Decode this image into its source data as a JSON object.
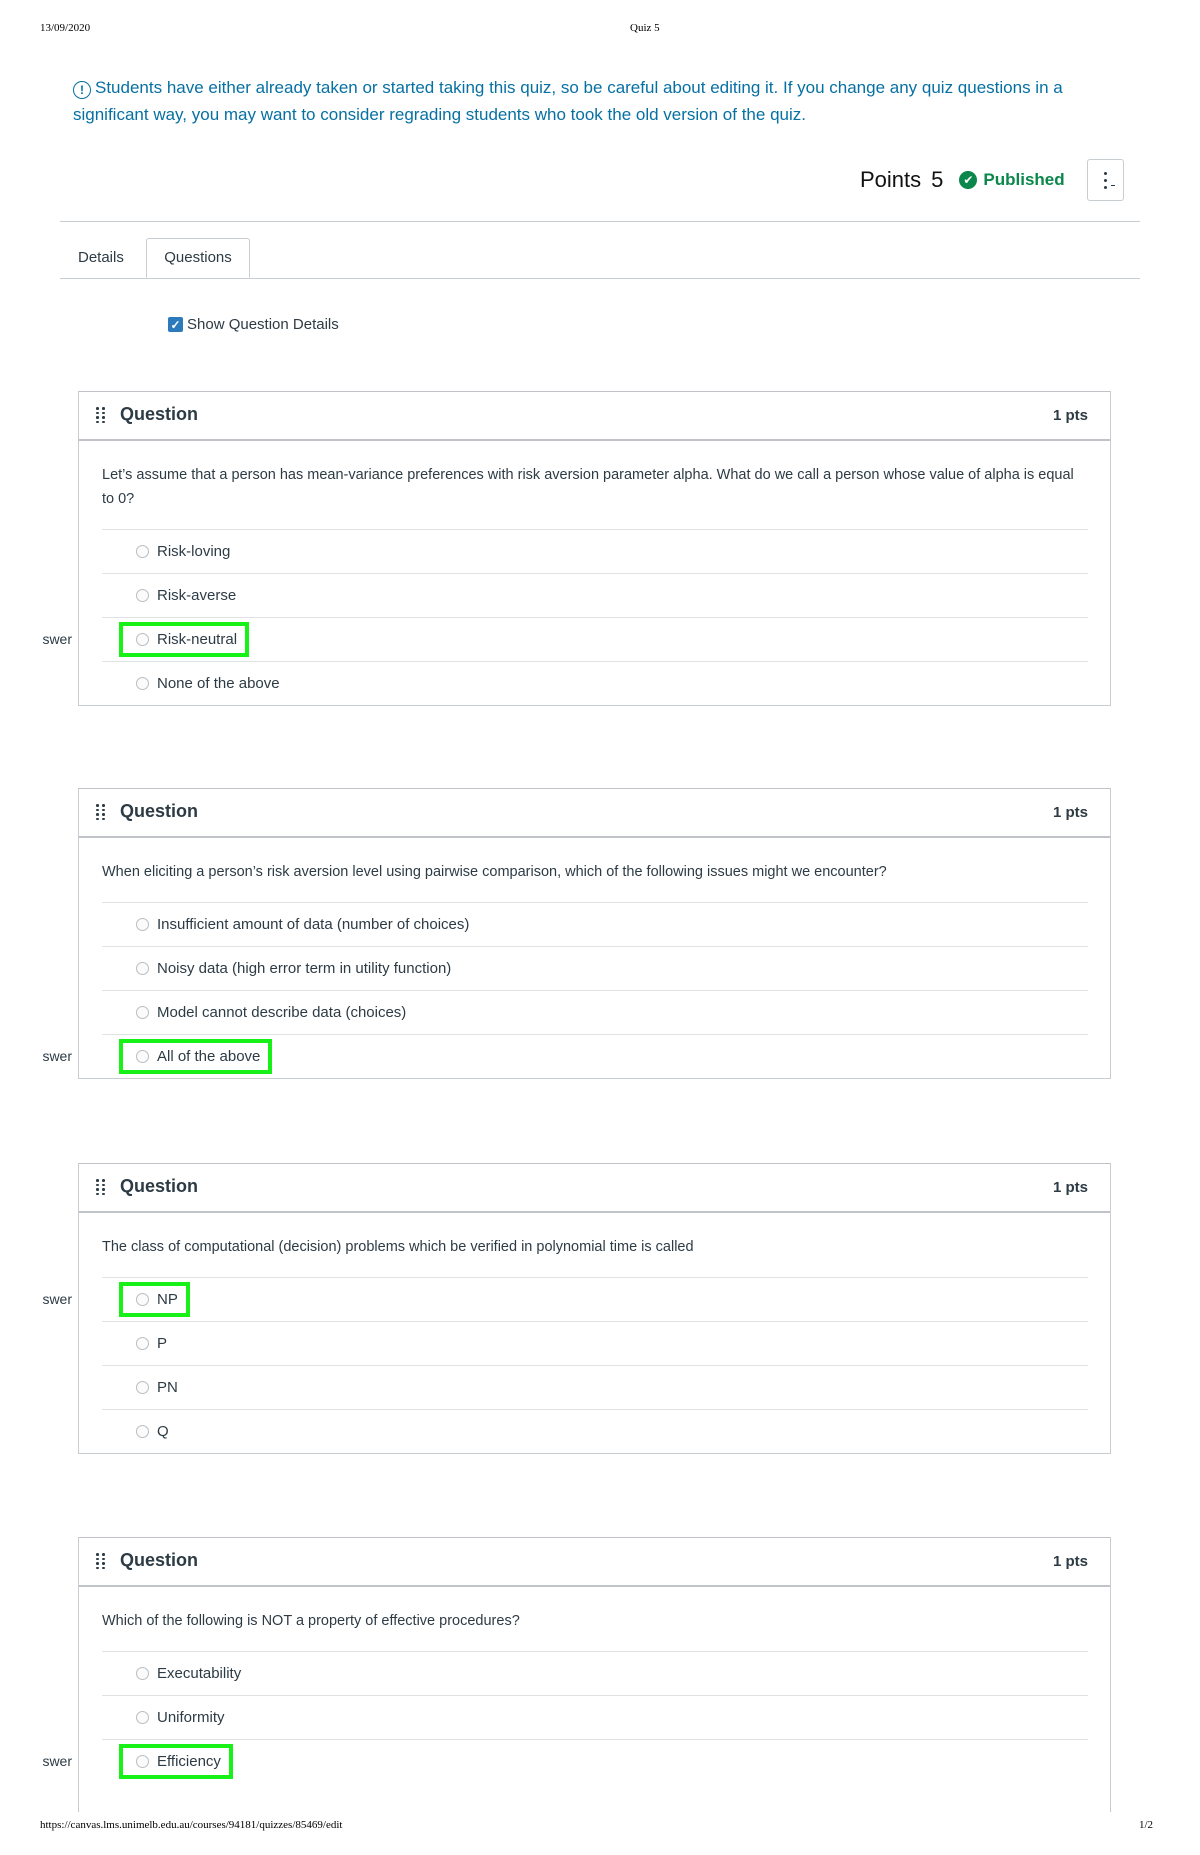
{
  "print": {
    "date": "13/09/2020",
    "title": "Quiz 5",
    "url": "https://canvas.lms.unimelb.edu.au/courses/94181/quizzes/85469/edit",
    "page": "1/2"
  },
  "warning": {
    "icon": "exclamation-circle-icon",
    "text": "Students have either already taken or started taking this quiz, so be careful about editing it. If you change any quiz questions in a significant way, you may want to consider regrading students who took the old version of the quiz."
  },
  "summary": {
    "points_label": "Points",
    "points_value": "5",
    "status_label": "Published",
    "status_color": "#0b874b",
    "more_icon": "kebab-menu-icon"
  },
  "tabs": [
    {
      "label": "Details",
      "active": false
    },
    {
      "label": "Questions",
      "active": true
    }
  ],
  "show_details": {
    "label": "Show Question Details",
    "checked": true
  },
  "answer_tag": "swer",
  "highlight_color": "#17f117",
  "questions": [
    {
      "title": "Question",
      "points": "1 pts",
      "text": "Let’s assume that a person has mean-variance preferences with risk aversion parameter alpha. What do we call a person whose value of alpha is equal to 0?",
      "options": [
        "Risk-loving",
        "Risk-averse",
        "Risk-neutral",
        "None of the above"
      ],
      "correct_index": 2
    },
    {
      "title": "Question",
      "points": "1 pts",
      "text": "When eliciting a person’s risk aversion level using pairwise comparison, which of the following issues might we encounter?",
      "options": [
        "Insufficient amount of data (number of choices)",
        "Noisy data (high error term in utility function)",
        "Model cannot describe data (choices)",
        "All of the above"
      ],
      "correct_index": 3
    },
    {
      "title": "Question",
      "points": "1 pts",
      "text": "The class of computational (decision) problems which be verified in polynomial time is called",
      "options": [
        "NP",
        "P",
        "PN",
        "Q"
      ],
      "correct_index": 0
    },
    {
      "title": "Question",
      "points": "1 pts",
      "text": "Which of the following is NOT a property of effective procedures?",
      "options": [
        "Executability",
        "Uniformity",
        "Efficiency"
      ],
      "correct_index": 2
    }
  ]
}
